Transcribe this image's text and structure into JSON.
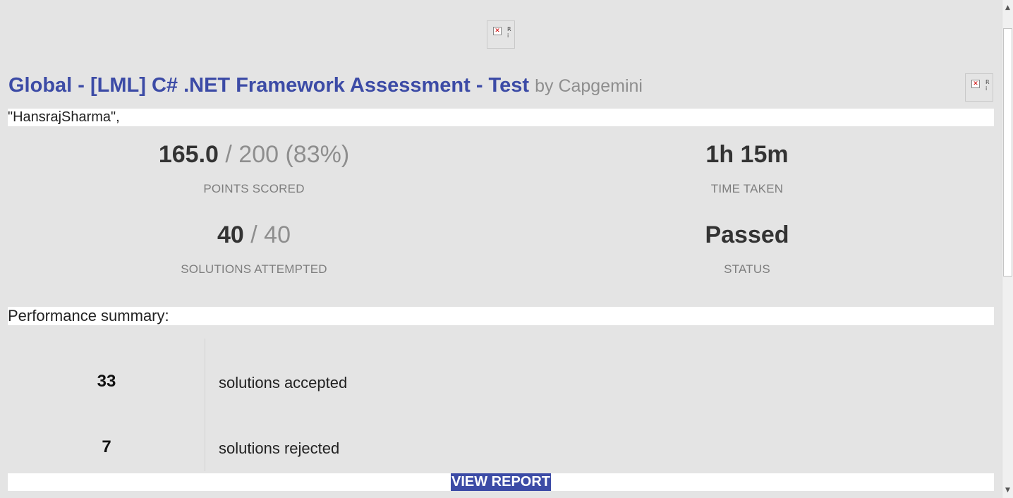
{
  "header": {
    "title": "Global - [LML] C# .NET Framework Assessment - Test",
    "by_line": "by Capgemini"
  },
  "logos": {
    "top_alt": "R i",
    "right_alt": "R i"
  },
  "candidate": {
    "name": "\"HansrajSharma\","
  },
  "stats": {
    "points": {
      "score": "165.0",
      "total": "/ 200 (83%)",
      "label": "POINTS SCORED"
    },
    "time": {
      "value": "1h 15m",
      "label": "TIME TAKEN"
    },
    "solutions": {
      "attempted": "40",
      "total": "/ 40",
      "label": "SOLUTIONS ATTEMPTED"
    },
    "status": {
      "value": "Passed",
      "label": "STATUS"
    }
  },
  "performance": {
    "heading": "Performance summary:",
    "rows": [
      {
        "count": "33",
        "text": "solutions accepted"
      },
      {
        "count": "7",
        "text": "solutions rejected"
      }
    ]
  },
  "actions": {
    "view_report_label": "VIEW REPORT"
  },
  "scrollbar": {
    "up_glyph": "▲",
    "down_glyph": "▼"
  }
}
